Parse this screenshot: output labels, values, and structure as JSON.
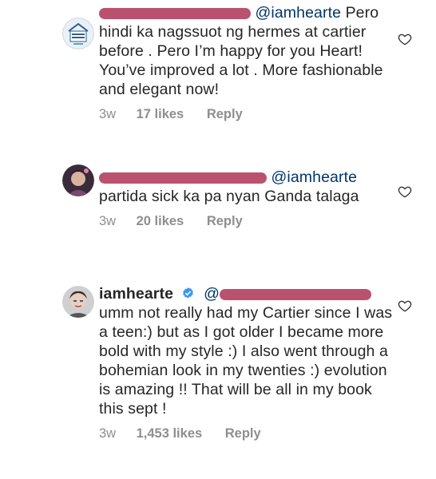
{
  "comments": [
    {
      "avatar": "work-from-home-logo",
      "mention": "@iamhearte",
      "text": "Pero hindi ka nagssuot ng hermes at cartier before . Pero I’m happy for you Heart! You’ve improved a lot . More fashionable and elegant now!",
      "time": "3w",
      "likes": "17 likes",
      "reply": "Reply"
    },
    {
      "avatar": "user-photo",
      "mention": "@iamhearte",
      "text": "partida sick ka pa nyan Ganda talaga",
      "time": "3w",
      "likes": "20 likes",
      "reply": "Reply"
    },
    {
      "avatar": "iamhearte-photo",
      "username": "iamhearte",
      "verified_icon": "verified-badge-icon",
      "mention": "@",
      "text": "umm not really had my Cartier since I was a teen:) but as I got older I became more bold with my style :) I also went through a bohemian look in my twenties :) evolution is amazing !! That will be all in my book this sept !",
      "time": "3w",
      "likes": "1,453 likes",
      "reply": "Reply"
    }
  ],
  "icons": {
    "like": "heart-outline-icon"
  },
  "colors": {
    "text": "#262626",
    "mention": "#003569",
    "meta": "#8e8e8e",
    "redaction": "#b03a5b",
    "verified": "#3897f0"
  }
}
